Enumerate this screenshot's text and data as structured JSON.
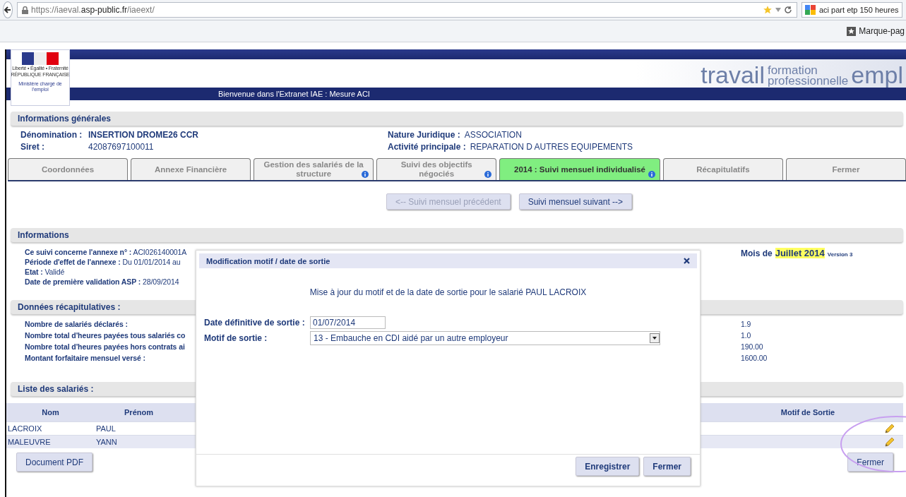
{
  "browser": {
    "url": "https://iaeval.**asp-public.fr**/iaeext/",
    "search_query": "aci part etp 150 heures",
    "bookmarks_label": "Marque-pag"
  },
  "banner": {
    "logo_lines": [
      "Liberté • Égalité • Fraternité",
      "RÉPUBLIQUE FRANÇAISE"
    ],
    "ministry": "Ministère chargé de l'emploi",
    "slogan_big": "travail",
    "slogan_top": "formation",
    "slogan_bottom": "professionnelle",
    "slogan_end": "empl",
    "welcome": "Bienvenue dans l'Extranet IAE : Mesure ACI"
  },
  "general": {
    "title": "Informations générales",
    "left": [
      {
        "label": "Dénomination :",
        "value": "INSERTION DROME26 CCR",
        "bold": true
      },
      {
        "label": "Siret :",
        "value": "42087697100011",
        "bold": false
      }
    ],
    "right": [
      {
        "label": "Nature Juridique :",
        "value": "ASSOCIATION"
      },
      {
        "label": "Activité principale :",
        "value": "REPARATION D AUTRES EQUIPEMENTS"
      }
    ]
  },
  "tabs": [
    {
      "label": "Coordonnées",
      "info": false,
      "selected": false
    },
    {
      "label": "Annexe Financière",
      "info": false,
      "selected": false
    },
    {
      "label": "Gestion des salariés de la structure",
      "info": true,
      "selected": false
    },
    {
      "label": "Suivi des objectifs négociés",
      "info": true,
      "selected": false
    },
    {
      "label": "2014 : Suivi mensuel individualisé",
      "info": true,
      "selected": true
    },
    {
      "label": "Récapitulatifs",
      "info": false,
      "selected": false
    },
    {
      "label": "Fermer",
      "info": false,
      "selected": false
    }
  ],
  "nav_buttons": [
    {
      "label": "<-- Suivi mensuel précédent",
      "disabled": true
    },
    {
      "label": "Suivi mensuel suivant -->",
      "disabled": false
    }
  ],
  "informations": {
    "title": "Informations",
    "rows": [
      {
        "label": "Ce suivi concerne l'annexe n° :",
        "value": "ACI026140001A"
      },
      {
        "label": "Période d'effet de l'annexe :",
        "value": "Du 01/01/2014 au"
      },
      {
        "label": "Etat :",
        "value": "Validé"
      },
      {
        "label": "Date de première validation ASP :",
        "value": "28/09/2014"
      }
    ],
    "month_prefix": "Mois de",
    "month": "Juillet 2014",
    "version": "Version 3"
  },
  "recap": {
    "title": "Données récapitulatives :",
    "rows": [
      {
        "label": "Nombre de salariés déclarés :",
        "value": "1.9"
      },
      {
        "label": "Nombre total d'heures payées tous salariés co",
        "value": "1.0"
      },
      {
        "label": "Nombre total d'heures payées hors contrats ai",
        "value": "190.00"
      },
      {
        "label": "Montant forfaitaire mensuel versé :",
        "value": "1600.00"
      }
    ]
  },
  "employees": {
    "title": "Liste des salariés :",
    "columns": [
      "Nom",
      "Prénom",
      "Motif de Sortie"
    ],
    "rows": [
      {
        "nom": "LACROIX",
        "prenom": "PAUL"
      },
      {
        "nom": "MALEUVRE",
        "prenom": "YANN"
      }
    ]
  },
  "bottom_buttons": [
    "Document PDF",
    "Fermer"
  ],
  "modal": {
    "title": "Modification motif / date de sortie",
    "message": "Mise à jour du motif et de la date de sortie pour le salarié PAUL LACROIX",
    "date_label": "Date définitive de sortie :",
    "date_value": "01/07/2014",
    "motif_label": "Motif de sortie :",
    "motif_value": "13 - Embauche en CDI aidé par un autre employeur",
    "buttons": [
      "Enregistrer",
      "Fermer"
    ]
  }
}
